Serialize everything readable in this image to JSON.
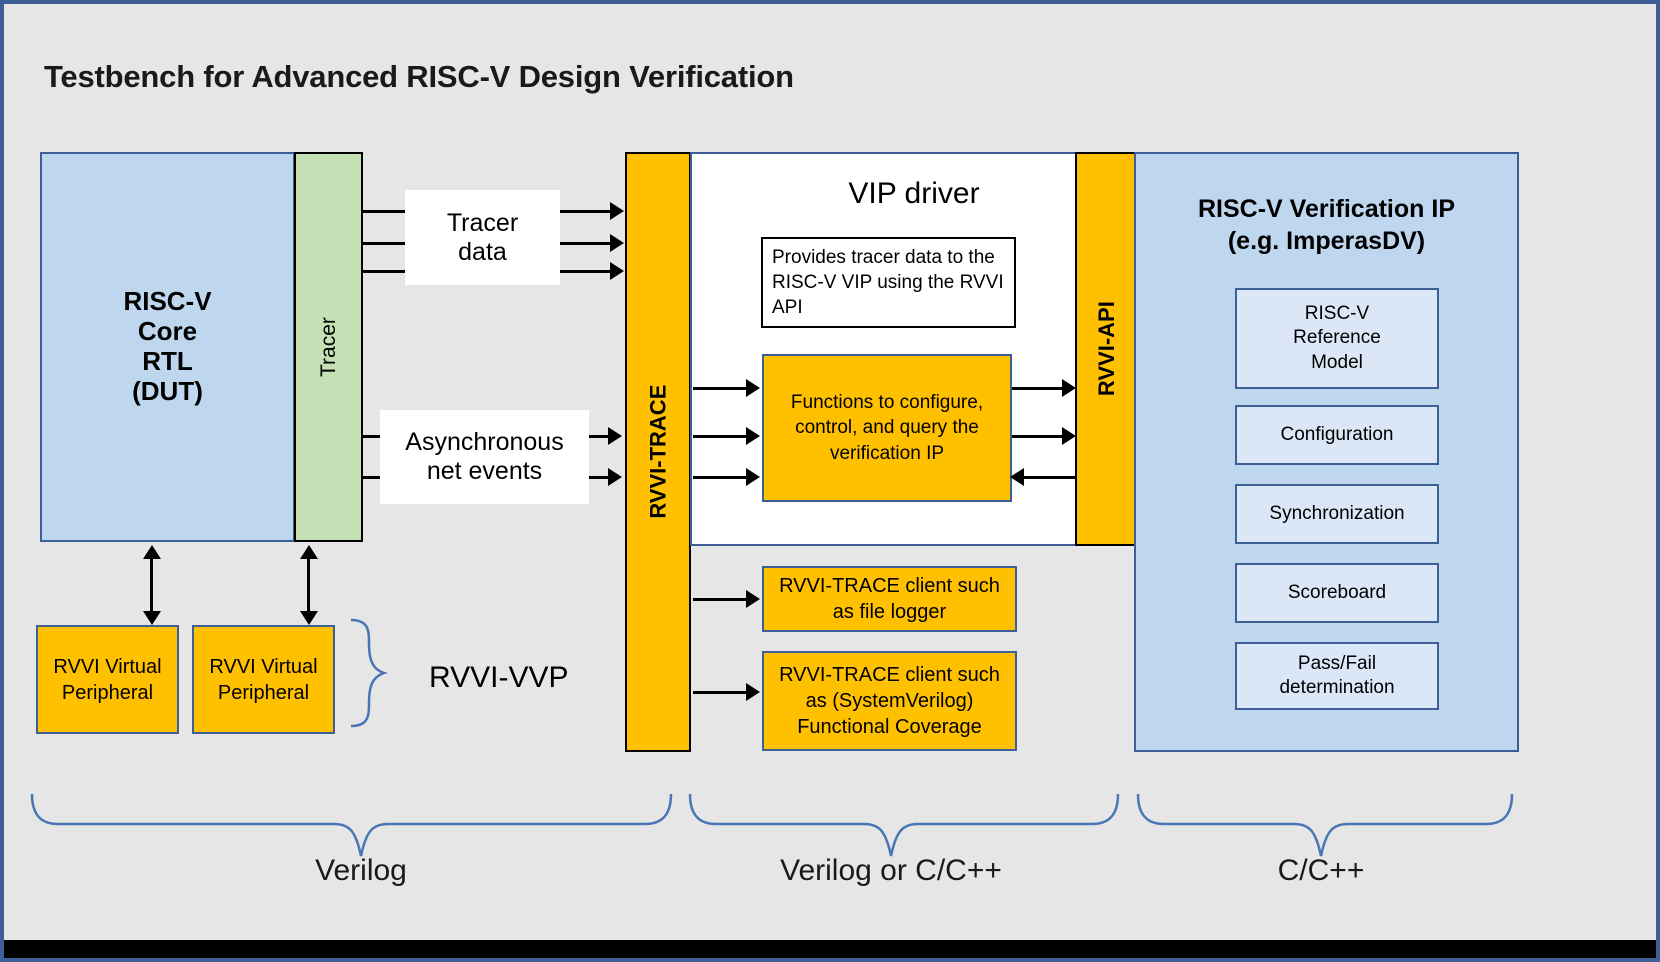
{
  "title": "Testbench for Advanced RISC-V Design Verification",
  "dut": {
    "core_label": "RISC-V\nCore\nRTL\n(DUT)",
    "tracer_label": "Tracer"
  },
  "signals": {
    "tracer_data": "Tracer\ndata",
    "async_events": "Asynchronous\nnet events"
  },
  "bars": {
    "rvvi_trace": "RVVI-TRACE",
    "rvvi_api": "RVVI-API"
  },
  "vip_driver": {
    "title": "VIP driver",
    "note": "Provides tracer data to the RISC-V VIP using the RVVI API",
    "functions": "Functions to configure, control, and query the verification IP"
  },
  "verification_ip": {
    "title": "RISC-V Verification IP\n(e.g. ImperasDV)",
    "boxes": [
      {
        "label": "RISC-V\nReference\nModel"
      },
      {
        "label": "Configuration"
      },
      {
        "label": "Synchronization"
      },
      {
        "label": "Scoreboard"
      },
      {
        "label": "Pass/Fail\ndetermination"
      }
    ]
  },
  "trace_clients": [
    {
      "label": "RVVI-TRACE client such\nas file logger"
    },
    {
      "label": "RVVI-TRACE client such\nas (SystemVerilog)\nFunctional Coverage"
    }
  ],
  "virtual_peripherals": [
    {
      "label": "RVVI Virtual\nPeripheral"
    },
    {
      "label": "RVVI Virtual\nPeripheral"
    }
  ],
  "vvp_label": "RVVI-VVP",
  "zones": [
    {
      "label": "Verilog"
    },
    {
      "label": "Verilog or C/C++"
    },
    {
      "label": "C/C++"
    }
  ],
  "colors": {
    "background": "#e6e6e6",
    "frame_blue": "#3c5f96",
    "core_blue": "#bed7ef",
    "tracer_green": "#c5e0b4",
    "orange": "#ffc000",
    "ip_box_blue": "#dbe6f6",
    "brace_blue": "#4876b4"
  }
}
